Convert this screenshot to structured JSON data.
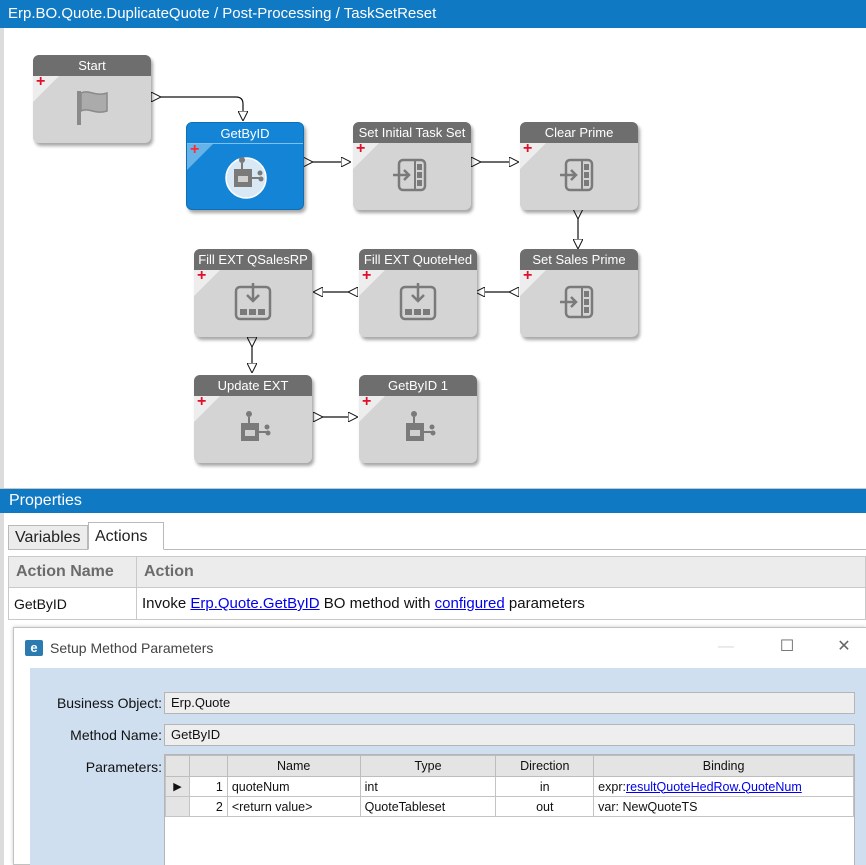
{
  "window_title": "Erp.BO.Quote.DuplicateQuote / Post-Processing / TaskSetReset",
  "nodes": {
    "start": "Start",
    "getbyid": "GetByID",
    "set_initial": "Set Initial Task Set",
    "clear_prime": "Clear Prime",
    "fill_qsalesrp": "Fill EXT QSalesRP",
    "fill_quotehed": "Fill EXT QuoteHed",
    "set_sales_prime": "Set Sales Prime",
    "update_ext": "Update EXT",
    "getbyid1": "GetByID 1"
  },
  "properties": {
    "header": "Properties",
    "tabs": [
      "Variables",
      "Actions"
    ],
    "active_tab": "Actions",
    "columns": [
      "Action Name",
      "Action"
    ],
    "row": {
      "name": "GetByID",
      "text_1": "Invoke ",
      "link_1": "Erp.Quote.GetByID",
      "text_2": " BO method with ",
      "link_2": "configured",
      "text_3": " parameters"
    }
  },
  "dialog": {
    "title": "Setup Method Parameters",
    "logo": "e",
    "business_object_label": "Business Object:",
    "business_object_value": "Erp.Quote",
    "method_name_label": "Method Name:",
    "method_name_value": "GetByID",
    "parameters_label": "Parameters:",
    "param_columns": [
      "Name",
      "Type",
      "Direction",
      "Binding"
    ],
    "params": [
      {
        "indicator": "▶",
        "num": "1",
        "name": "quoteNum",
        "type": "int",
        "direction": "in",
        "binding_prefix": "expr:",
        "binding_link": "resultQuoteHedRow.QuoteNum"
      },
      {
        "indicator": "",
        "num": "2",
        "name": "<return value>",
        "type": "QuoteTableset",
        "direction": "out",
        "binding_prefix": "var: NewQuoteTS",
        "binding_link": ""
      }
    ]
  },
  "colors": {
    "title_blue": "#1079c4",
    "node_gray": "#d4d4d4",
    "node_header": "#6e6e6e",
    "selected_blue": "#1384d6",
    "add_red": "#e0102a",
    "dialog_panel": "#cfdff0"
  }
}
